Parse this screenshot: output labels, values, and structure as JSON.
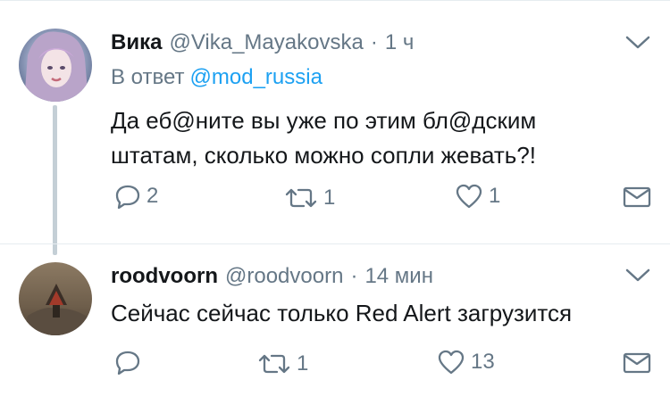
{
  "tweets": [
    {
      "name": "Вика",
      "handle": "@Vika_Mayakovska",
      "time": "1 ч",
      "reply_prefix": "В ответ",
      "reply_mention": "@mod_russia",
      "text_lines": [
        "Да еб@ните вы уже по этим бл@дским",
        "штатам, сколько можно сопли жевать?!"
      ],
      "actions": {
        "reply_count": "2",
        "retweet_count": "1",
        "like_count": "1"
      }
    },
    {
      "name": "roodvoorn",
      "handle": "@roodvoorn",
      "time": "14 мин",
      "text_lines": [
        "Сейчас сейчас только Red Alert загрузится"
      ],
      "actions": {
        "reply_count": "",
        "retweet_count": "1",
        "like_count": "13"
      }
    }
  ],
  "icons": {
    "more": "chevron-down-icon",
    "reply": "reply-icon",
    "retweet": "retweet-icon",
    "like": "heart-icon",
    "dm": "envelope-icon"
  },
  "colors": {
    "icon_gray": "#657786",
    "link_blue": "#1da1f2",
    "text": "#14171a",
    "thread_line": "#c4cfd6"
  }
}
